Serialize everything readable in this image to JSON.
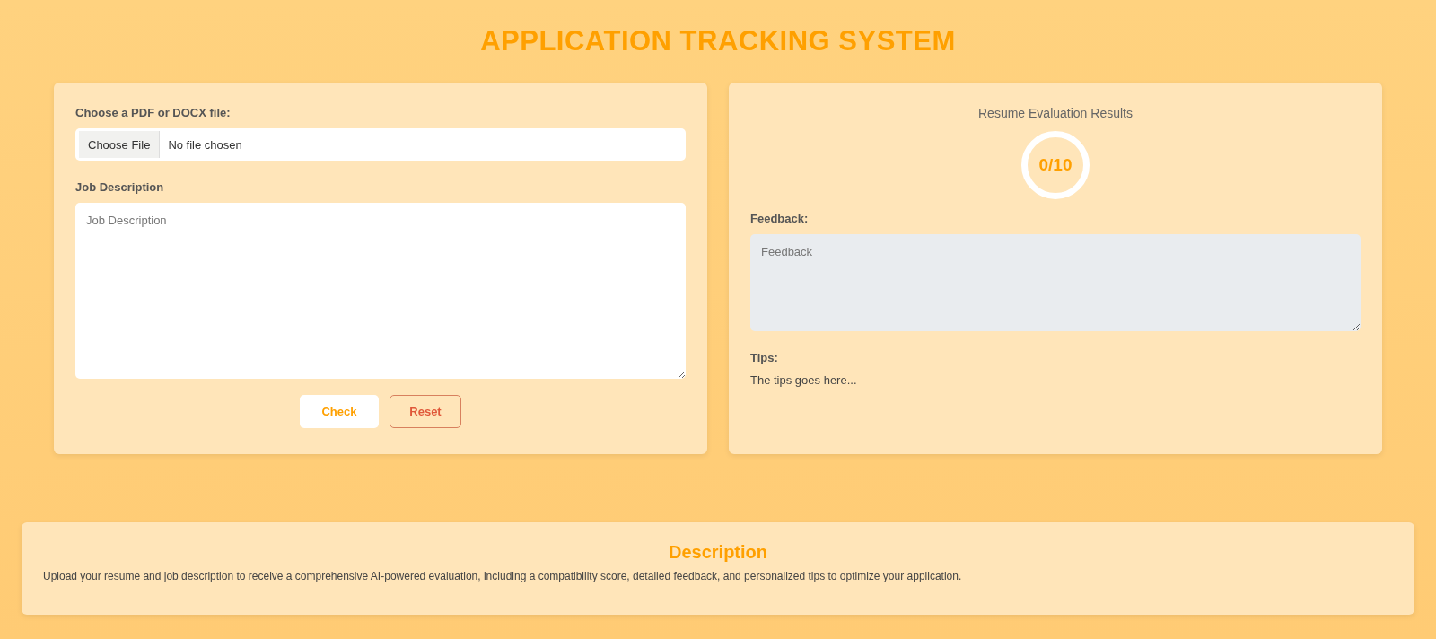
{
  "title": "APPLICATION TRACKING SYSTEM",
  "upload": {
    "file_label": "Choose a PDF or DOCX file:",
    "file_button": "Choose File",
    "file_status": "No file chosen",
    "job_label": "Job Description",
    "job_placeholder": "Job Description",
    "buttons": [
      {
        "label": "Check",
        "kind": "primary"
      },
      {
        "label": "Reset",
        "kind": "outline"
      }
    ]
  },
  "results": {
    "heading": "Resume Evaluation Results",
    "score": "0/10",
    "feedback_label": "Feedback:",
    "feedback_placeholder": "Feedback",
    "tips_label": "Tips:",
    "tips_text": "The tips goes here..."
  },
  "description": {
    "heading": "Description",
    "text": "Upload your resume and job description to receive a comprehensive AI-powered evaluation, including a compatibility score, detailed feedback, and personalized tips to optimize your application."
  }
}
